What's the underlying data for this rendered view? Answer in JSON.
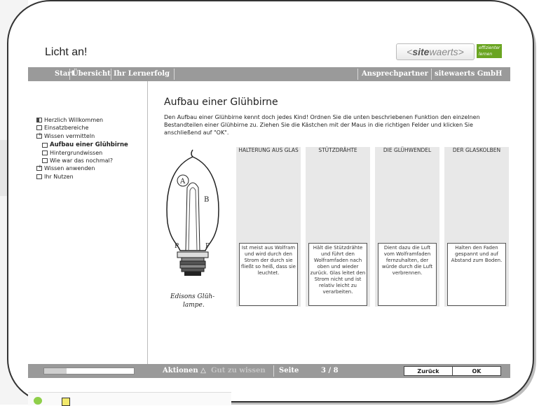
{
  "app": {
    "title": "Licht an!",
    "logo_text_bold": "site",
    "logo_text_rest": "waerts",
    "logo_prefix": "<",
    "logo_suffix": ">",
    "logo_tagline": "effizienter lernen",
    "brand_color": "#6aa521"
  },
  "nav": {
    "items": [
      "Start",
      "Übersicht",
      "Ihr Lernerfolg"
    ],
    "right_items": [
      "Ansprechpartner",
      "sitewaerts GmbH"
    ]
  },
  "sidebar": {
    "items": [
      {
        "label": "Herzlich Willkommen",
        "icon": "half-box-icon"
      },
      {
        "label": "Einsatzbereiche",
        "icon": "box-icon"
      },
      {
        "label": "Wissen vermitteln",
        "icon": "expanded-box-icon"
      },
      {
        "label": "Aufbau einer Glühbirne",
        "icon": "box-icon",
        "active": true
      },
      {
        "label": "Hintergrundwissen",
        "icon": "box-icon"
      },
      {
        "label": "Wie war das nochmal?",
        "icon": "box-icon"
      },
      {
        "label": "Wissen anwenden",
        "icon": "expanded-box-icon"
      },
      {
        "label": "Ihr Nutzen",
        "icon": "box-icon"
      }
    ]
  },
  "main": {
    "heading": "Aufbau einer Glühbirne",
    "intro": "Den Aufbau einer Glühbirne kennt doch jedes Kind! Ordnen Sie die unten beschriebenen Funktion den einzelnen Bestandteilen einer Glühbirne zu. Ziehen Sie die Kästchen mit der Maus in die richtigen Felder und klicken Sie anschließend auf \"OK\".",
    "image_caption_1": "Edisons Glüh-",
    "image_caption_2": "lampe.",
    "bulb_letters": [
      "A",
      "B",
      "P",
      "P"
    ],
    "columns": [
      {
        "header": "HALTERUNG AUS GLAS",
        "card": "Ist meist aus Wolfram und wird durch den Strom der durch sie fließt so heiß, dass sie leuchtet."
      },
      {
        "header": "STÜTZDRÄHTE",
        "card": "Hält die Stützdrähte und führt den Wolframfaden nach oben und wieder zurück. Glas leitet den Strom nicht und ist relativ leicht zu verarbeiten."
      },
      {
        "header": "DIE GLÜHWENDEL",
        "card": "Dient dazu die Luft vom Wolframfaden fernzuhalten, der würde durch die Luft verbrennen."
      },
      {
        "header": "DER GLASKOLBEN",
        "card": "Halten den Faden gespannt und auf Abstand zum Boden."
      }
    ]
  },
  "footer": {
    "progress": 0.25,
    "aktionen": "Aktionen",
    "gut_zu_wissen": "Gut zu wissen",
    "seite_label": "Seite",
    "page": "3 / 8",
    "back_label": "Zurück",
    "ok_label": "OK"
  }
}
